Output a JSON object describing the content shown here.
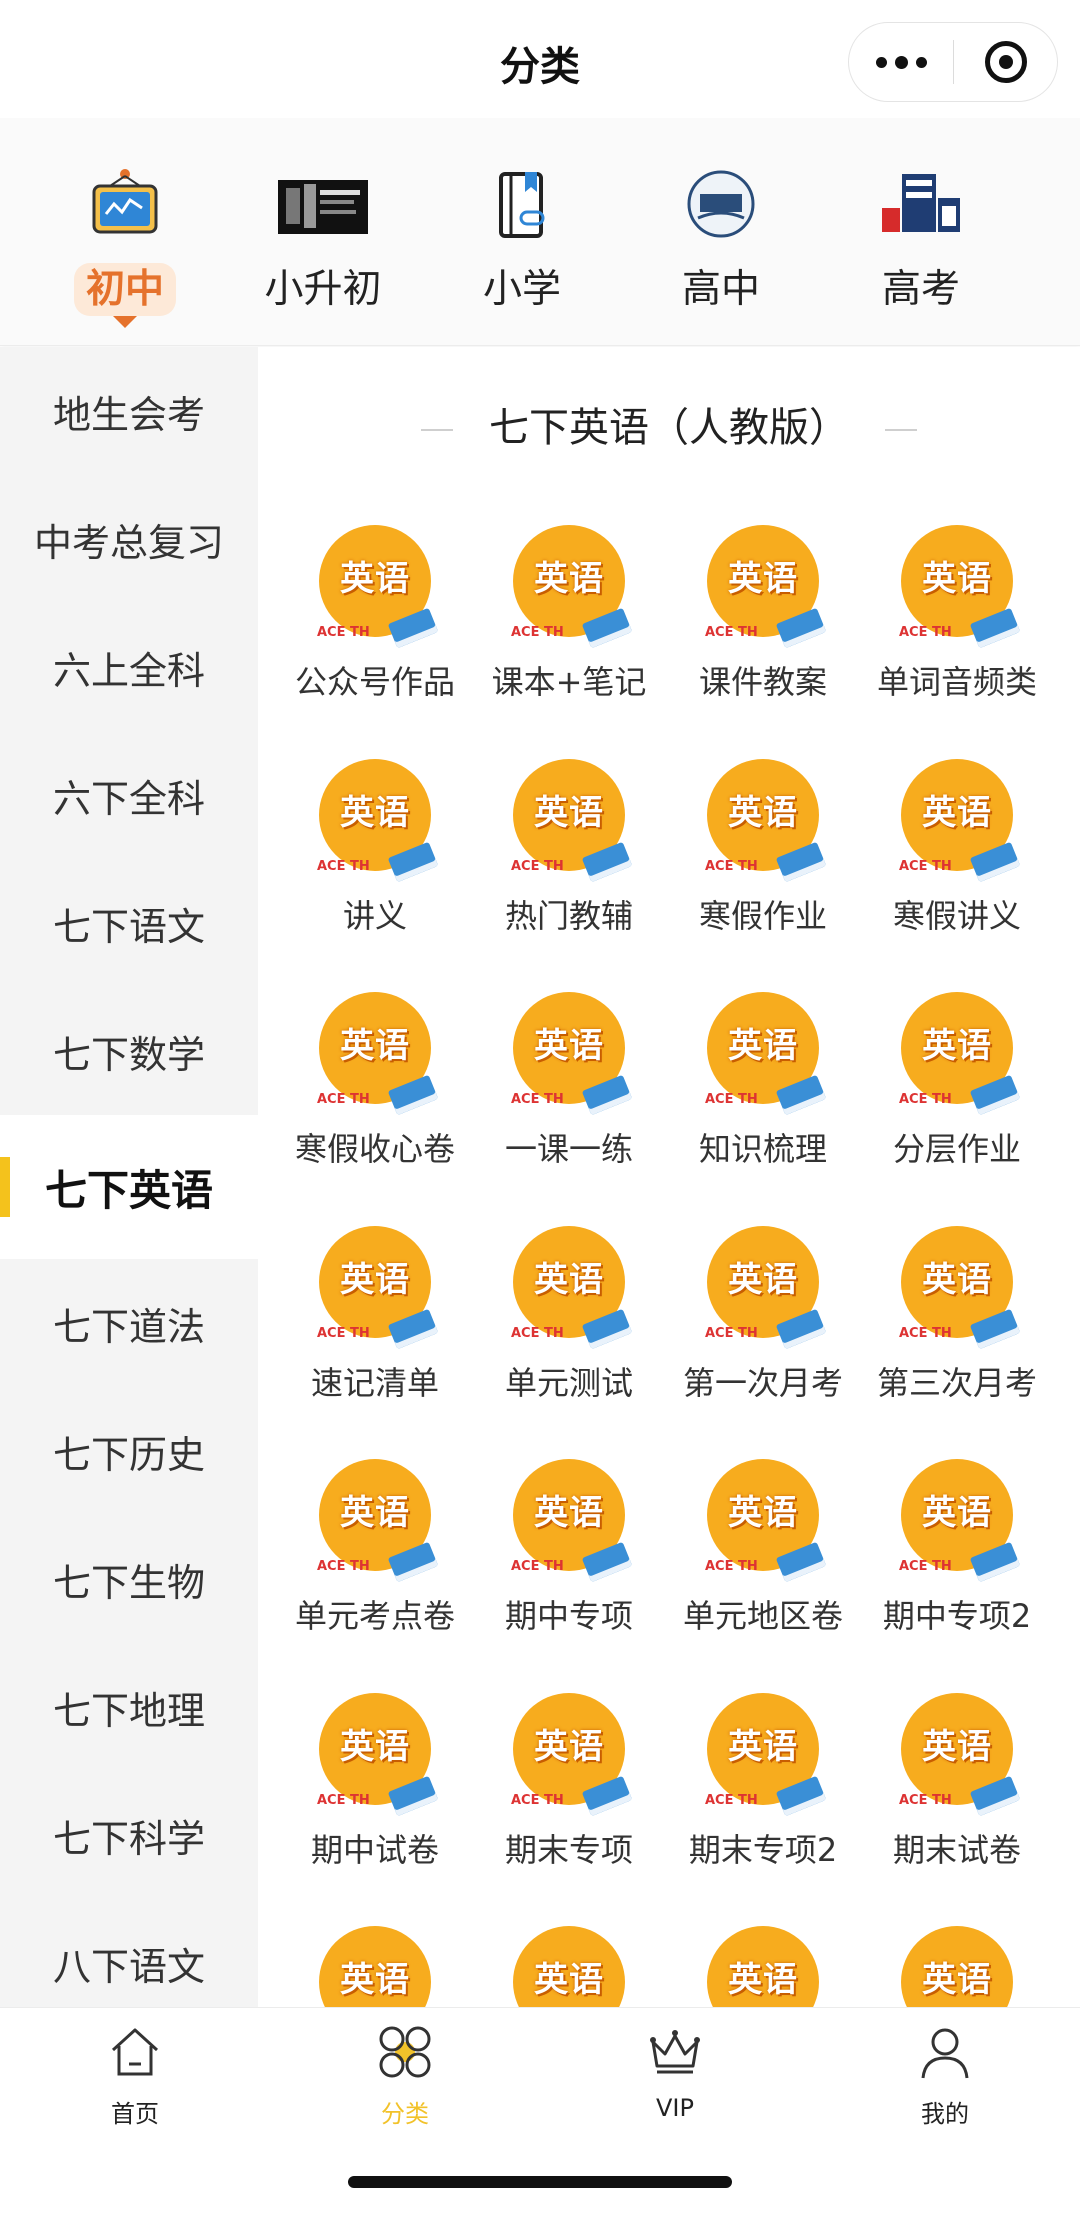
{
  "header": {
    "title": "分类"
  },
  "grades": [
    {
      "label": "初中",
      "icon": "blackboard-icon",
      "active": true
    },
    {
      "label": "小升初",
      "icon": "banner-thumbnail",
      "active": false
    },
    {
      "label": "小学",
      "icon": "notebook-link-icon",
      "active": false
    },
    {
      "label": "高中",
      "icon": "high-school-badge",
      "active": false
    },
    {
      "label": "高考",
      "icon": "gaokao-logo",
      "active": false
    }
  ],
  "sidebar": {
    "items": [
      "地生会考",
      "中考总复习",
      "六上全科",
      "六下全科",
      "七下语文",
      "七下数学",
      "七下英语",
      "七下道法",
      "七下历史",
      "七下生物",
      "七下地理",
      "七下科学",
      "八下语文"
    ],
    "active_index": 6
  },
  "section": {
    "title": "七下英语（人教版）"
  },
  "thumbnail": {
    "word": "英语",
    "letters": "ACE TH",
    "colors": {
      "sun": "#f7ac1e",
      "book": "#3a8fd6"
    }
  },
  "grid": {
    "items": [
      "公众号作品",
      "课本+笔记",
      "课件教案",
      "单词音频类",
      "讲义",
      "热门教辅",
      "寒假作业",
      "寒假讲义",
      "寒假收心卷",
      "一课一练",
      "知识梳理",
      "分层作业",
      "速记清单",
      "单元测试",
      "第一次月考",
      "第三次月考",
      "单元考点卷",
      "期中专项",
      "单元地区卷",
      "期中专项2",
      "期中试卷",
      "期末专项",
      "期末专项2",
      "期末试卷",
      "",
      "",
      "",
      ""
    ]
  },
  "tabbar": {
    "items": [
      {
        "label": "首页",
        "icon": "home-icon"
      },
      {
        "label": "分类",
        "icon": "category-icon"
      },
      {
        "label": "VIP",
        "icon": "crown-icon"
      },
      {
        "label": "我的",
        "icon": "profile-icon"
      }
    ],
    "active_index": 1,
    "colors": {
      "active": "#f2c22a"
    }
  },
  "colors": {
    "accent_orange": "#e5722c",
    "sidebar_marker": "#f4c21c"
  }
}
